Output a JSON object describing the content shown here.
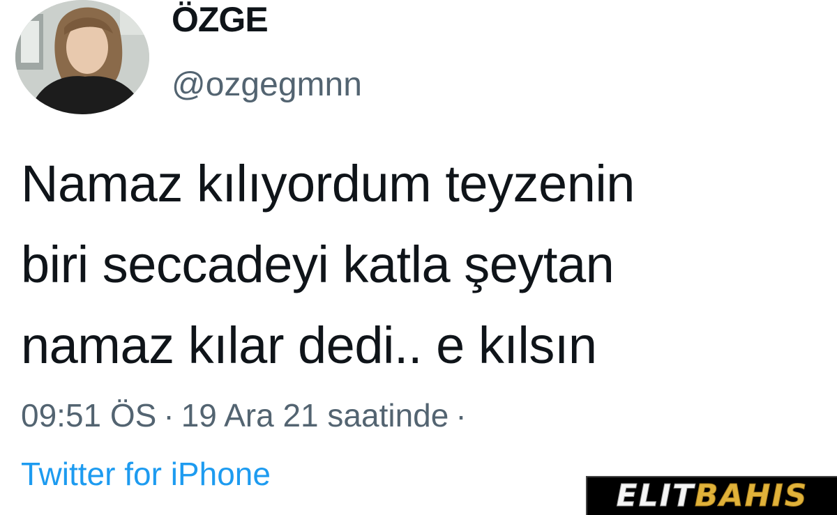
{
  "author": {
    "display_name": "ÖZGE",
    "handle": "@ozgegmnn"
  },
  "tweet": {
    "lines": [
      "Namaz kılıyordum teyzenin",
      "biri seccadeyi katla şeytan",
      "namaz kılar dedi.. e kılsın"
    ]
  },
  "meta": {
    "time": "09:51 ÖS",
    "separator": "·",
    "date": "19 Ara 21 saatinde",
    "trailing_separator": "·",
    "source": "Twitter for iPhone"
  },
  "watermark": {
    "part1": "ELIT",
    "part2": "BAHIS"
  },
  "colors": {
    "text": "#0f1419",
    "secondary": "#536471",
    "link": "#1d9bf0"
  }
}
